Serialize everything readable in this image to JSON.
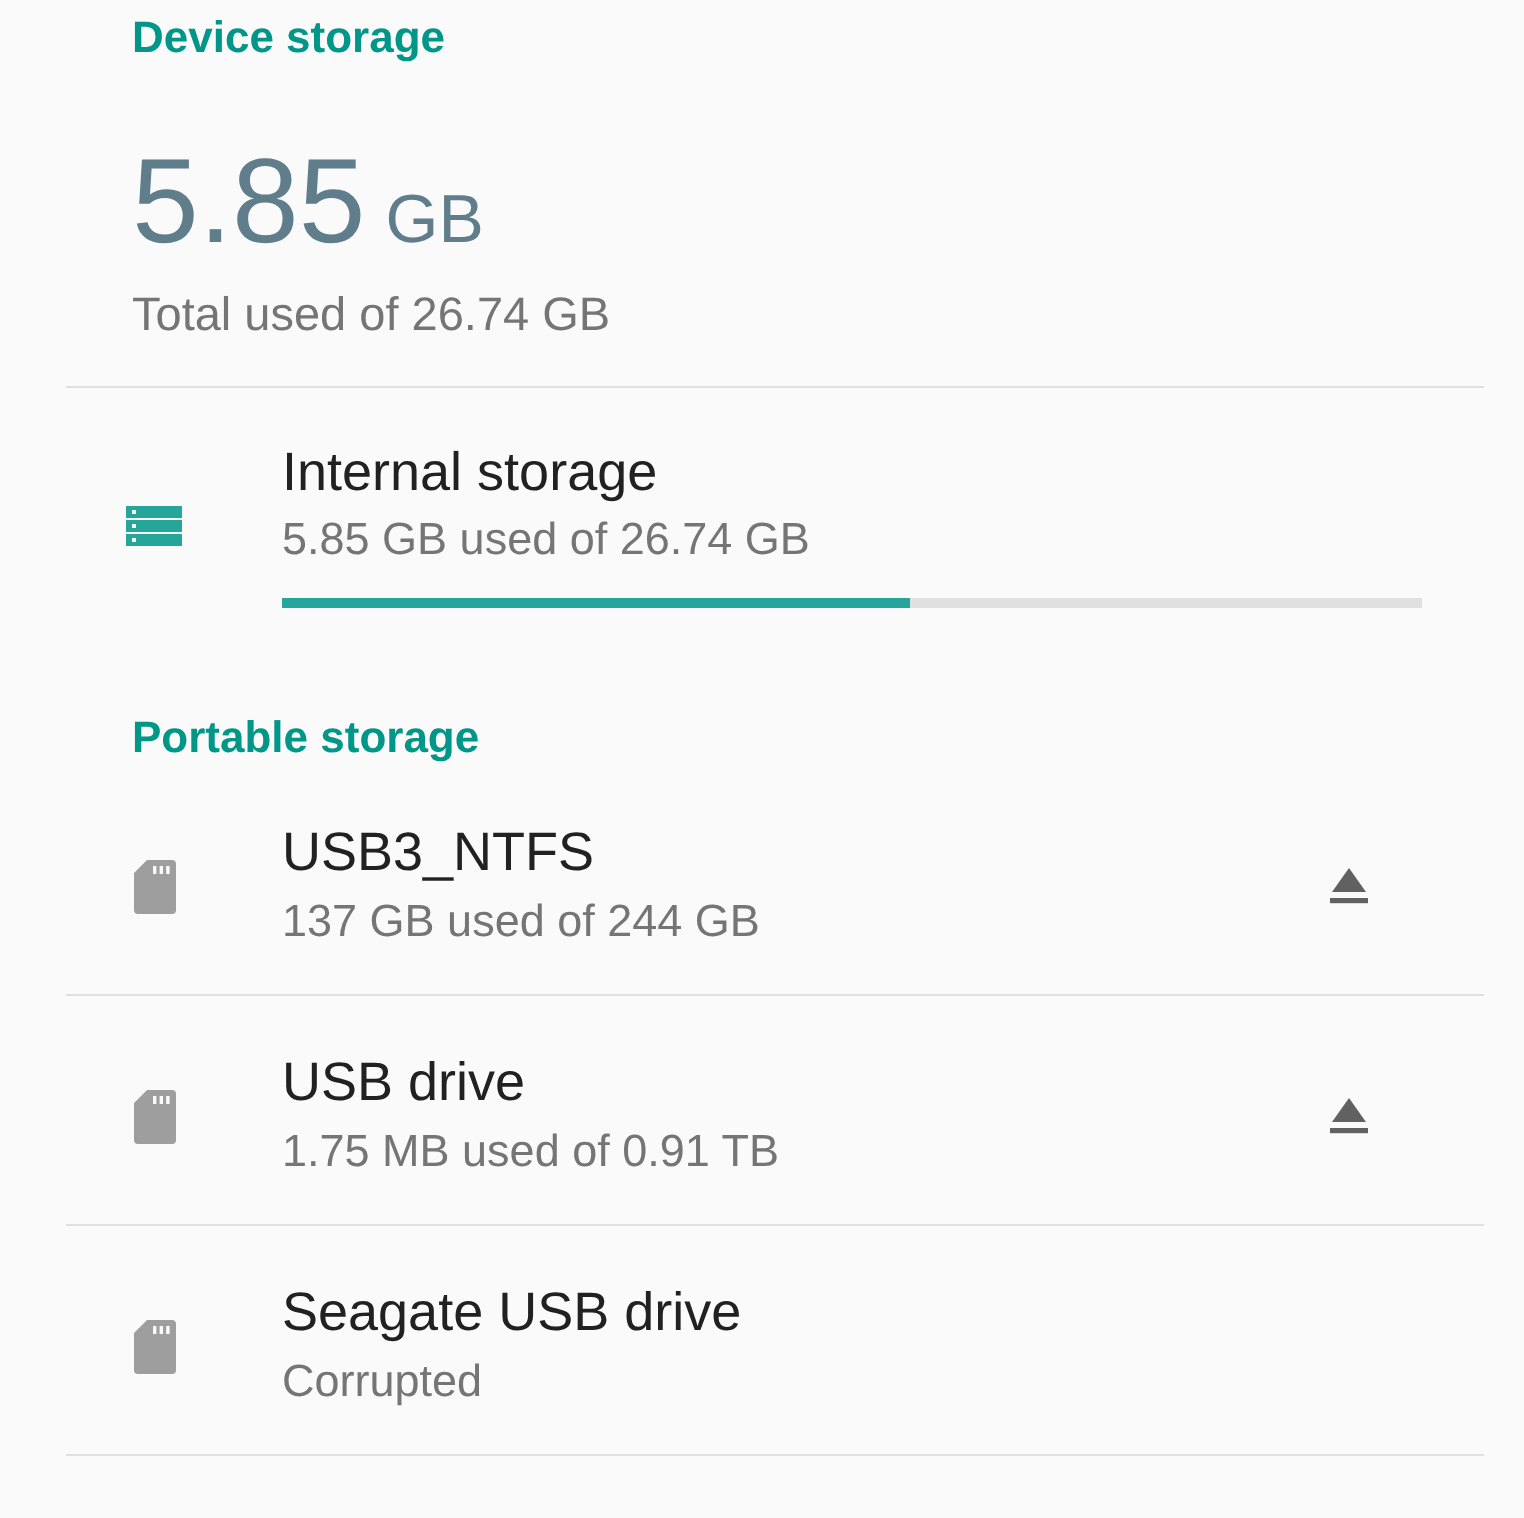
{
  "sections": [
    {
      "title": "Device storage",
      "total": {
        "amount": "5.85",
        "unit": "GB",
        "caption": "Total used of 26.74 GB"
      },
      "volumes": [
        {
          "kind": "internal",
          "name": "Internal storage",
          "detail": "5.85 GB used of 26.74 GB",
          "level": 0.55
        }
      ]
    },
    {
      "title": "Portable storage",
      "volumes": [
        {
          "kind": "portable",
          "name": "USB3_NTFS",
          "detail": "137 GB used of 244 GB",
          "ejectable": true
        },
        {
          "kind": "portable",
          "name": "USB drive",
          "detail": "1.75 MB used of 0.91 TB",
          "ejectable": true
        },
        {
          "kind": "portable",
          "name": "Seagate USB drive",
          "detail": "Corrupted",
          "ejectable": false
        }
      ]
    }
  ]
}
